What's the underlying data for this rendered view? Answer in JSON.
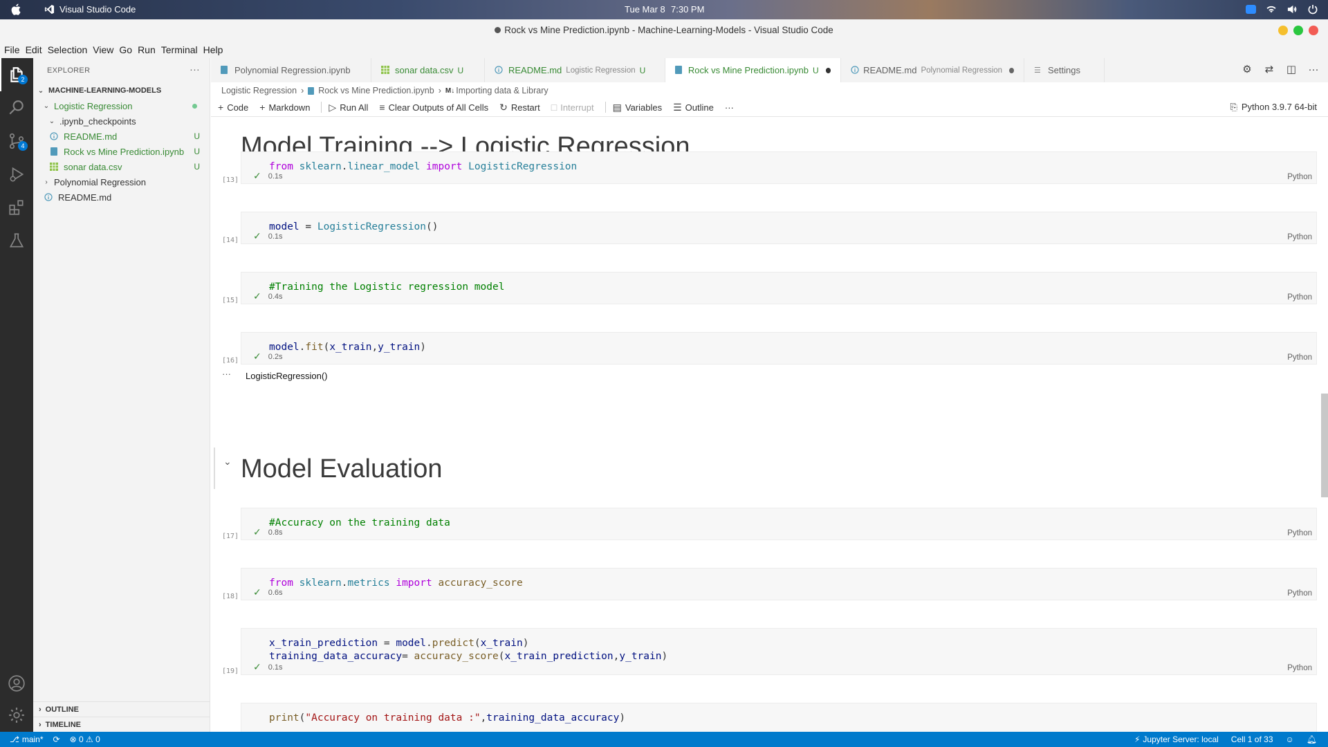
{
  "mac": {
    "app_name": "Visual Studio Code",
    "date": "Tue Mar 8",
    "time": "7:30 PM"
  },
  "window": {
    "title": "Rock vs Mine Prediction.ipynb - Machine-Learning-Models - Visual Studio Code"
  },
  "menu": [
    "File",
    "Edit",
    "Selection",
    "View",
    "Go",
    "Run",
    "Terminal",
    "Help"
  ],
  "activity": {
    "explorer_badge": "2",
    "scm_badge": "4"
  },
  "sidebar": {
    "title": "EXPLORER",
    "root": "MACHINE-LEARNING-MODELS",
    "items": [
      {
        "label": "Logistic Regression"
      },
      {
        "label": ".ipynb_checkpoints"
      },
      {
        "label": "README.md",
        "status": "U"
      },
      {
        "label": "Rock vs Mine Prediction.ipynb",
        "status": "U"
      },
      {
        "label": "sonar data.csv",
        "status": "U"
      },
      {
        "label": "Polynomial Regression"
      },
      {
        "label": "README.md"
      }
    ],
    "outline": "OUTLINE",
    "timeline": "TIMELINE"
  },
  "tabs": [
    {
      "label": "Polynomial Regression.ipynb",
      "desc": "",
      "status": ""
    },
    {
      "label": "sonar data.csv",
      "desc": "",
      "status": "U"
    },
    {
      "label": "README.md",
      "desc": "Logistic Regression",
      "status": "U"
    },
    {
      "label": "Rock vs Mine Prediction.ipynb",
      "desc": "",
      "status": "U"
    },
    {
      "label": "README.md",
      "desc": "Polynomial Regression",
      "status": ""
    },
    {
      "label": "Settings",
      "desc": "",
      "status": ""
    }
  ],
  "breadcrumb": {
    "folder": "Logistic Regression",
    "file": "Rock vs Mine Prediction.ipynb",
    "md_badge": "M↓",
    "section": "Importing data & Library"
  },
  "toolbar": {
    "code": "Code",
    "markdown": "Markdown",
    "run_all": "Run All",
    "clear": "Clear Outputs of All Cells",
    "restart": "Restart",
    "interrupt": "Interrupt",
    "variables": "Variables",
    "outline": "Outline",
    "more": "···",
    "kernel": "Python 3.9.7 64-bit"
  },
  "notebook": {
    "heading1": "Model Training --> Logistic Regression",
    "heading2": "Model Evaluation",
    "language": "Python",
    "cells": [
      {
        "num": "[13]",
        "time": "0.1s"
      },
      {
        "num": "[14]",
        "time": "0.1s"
      },
      {
        "num": "[15]",
        "time": "0.4s"
      },
      {
        "num": "[16]",
        "time": "0.2s"
      },
      {
        "num": "[17]",
        "time": "0.8s"
      },
      {
        "num": "[18]",
        "time": "0.6s"
      },
      {
        "num": "[19]",
        "time": "0.1s"
      }
    ],
    "code": {
      "c13": {
        "kw1": "from",
        "mod": "sklearn",
        "sub": "linear_model",
        "kw2": "import",
        "cls": "LogisticRegression"
      },
      "c14": {
        "var": "model",
        "op": " = ",
        "cls": "LogisticRegression",
        "paren": "()"
      },
      "c15": {
        "comment": "#Training the Logistic regression model"
      },
      "c16": {
        "var": "model",
        "fn": "fit",
        "args": "x_train",
        "sep": ",",
        "args2": "y_train"
      },
      "c17": {
        "comment": "#Accuracy on the training data"
      },
      "c18": {
        "kw1": "from",
        "mod": "sklearn",
        "sub": "metrics",
        "kw2": "import",
        "fn": "accuracy_score"
      },
      "c19a": {
        "var": "x_train_prediction",
        "op": " = ",
        "obj": "model",
        "fn": "predict",
        "arg": "x_train"
      },
      "c19b": {
        "var": "training_data_accuracy",
        "op": "= ",
        "fn": "accuracy_score",
        "a1": "x_train_prediction",
        "a2": "y_train"
      },
      "c20": {
        "fn": "print",
        "str": "\"Accuracy on training data :\"",
        "arg": "training_data_accuracy"
      }
    },
    "output": "LogisticRegression()",
    "output_ellipsis": "···"
  },
  "status": {
    "branch": "main*",
    "errors": "0",
    "warnings": "0",
    "jupyter": "Jupyter Server: local",
    "cell": "Cell 1 of 33"
  },
  "colors": {
    "accent": "#007acc",
    "green": "#388a34",
    "activity_bg": "#2c2c2c"
  }
}
